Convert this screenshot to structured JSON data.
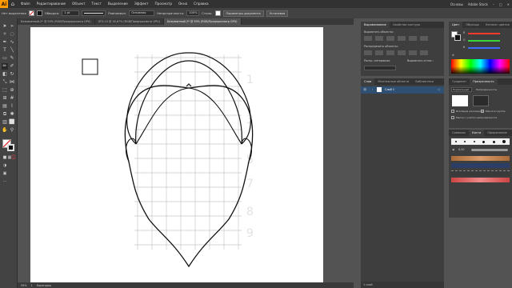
{
  "app": {
    "logo": "Ai"
  },
  "menu": {
    "items": [
      "Файл",
      "Редактирование",
      "Объект",
      "Текст",
      "Выделение",
      "Эффект",
      "Просмотр",
      "Окно",
      "Справка"
    ],
    "right": [
      "Основы",
      "Adobe Stock"
    ]
  },
  "control_bar": {
    "selection_label": "Нет выделения",
    "stroke_label": "Обводка:",
    "stroke_value": "1 pt",
    "brush_label": "Равномерн.",
    "profile_label": "Основная",
    "opacity_label": "Непрозрачность:",
    "opacity_value": "100%",
    "style_label": "Стиль:",
    "doc_setup_button": "Параметры документа",
    "prefs_button": "Установки"
  },
  "tabs": [
    "Безымянный-2* @ 50% (RGB/Предпросмотр GPU)",
    "GFX-10 @ 16,67% (RGB/Предпросмотр GPU)",
    "Безымянный-2* @ 59% (RGB/Предпросмотр GPU)"
  ],
  "active_tab_index": 2,
  "status_bar": {
    "zoom": "59%",
    "artboard": "1",
    "mode": "Карандаш"
  },
  "panel_align": {
    "tabs": [
      "Выравнивание",
      "Свойства контура"
    ],
    "labels": [
      "Выровнять объекты:",
      "Распределить объекты:",
      "Распр. интервалы:",
      "Выровнять относ.:"
    ]
  },
  "panel_layers": {
    "tabs": [
      "Слои",
      "Монтажные области",
      "Библиотеки"
    ],
    "layer_name": "Слой 1",
    "footer": "1 слой"
  },
  "panel_color": {
    "tabs": [
      "Цвет",
      "Образцы",
      "Каталог цветов"
    ],
    "channels": [
      "R",
      "G",
      "B"
    ],
    "channel_colors": [
      "#ff3b30",
      "#39d839",
      "#3b6bff"
    ],
    "hex": "#"
  },
  "panel_transparency": {
    "tabs": [
      "Градиент",
      "Прозрачность"
    ],
    "blend_mode": "Нормальный",
    "opacity_label": "Непрозрачность:",
    "opacity_value": "100%",
    "options": [
      "Изоляция наложения",
      "Маска в группе",
      "Маска с учетом непрозрачности"
    ]
  },
  "panel_brushes": {
    "tabs": [
      "Символы",
      "Кисти",
      "Оформление"
    ],
    "brush_size": "6,00"
  }
}
